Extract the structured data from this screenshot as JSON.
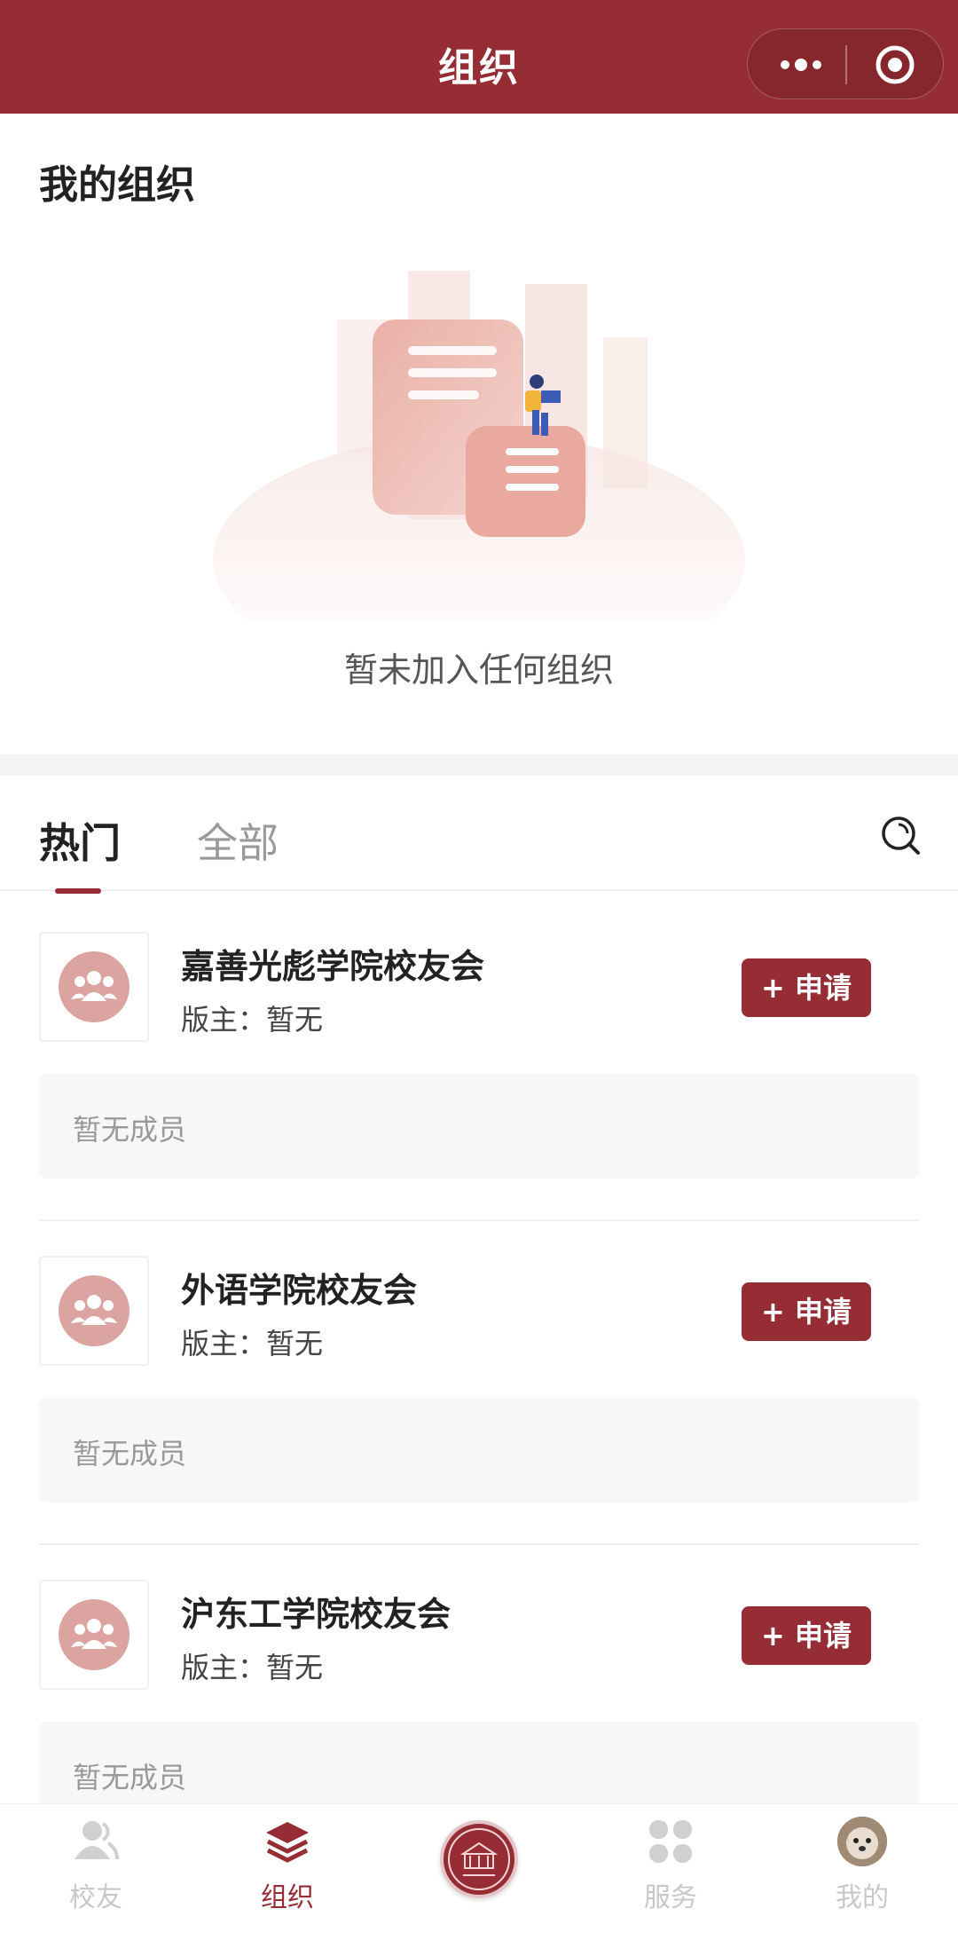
{
  "header": {
    "title": "组织"
  },
  "my_orgs": {
    "title": "我的组织",
    "empty_text": "暂未加入任何组织"
  },
  "tabs": [
    {
      "label": "热门",
      "active": true
    },
    {
      "label": "全部",
      "active": false
    }
  ],
  "orgs": [
    {
      "name": "嘉善光彪学院校友会",
      "owner_label": "版主：",
      "owner_value": "暂无",
      "apply_label": "+ 申请",
      "members_text": "暂无成员"
    },
    {
      "name": "外语学院校友会",
      "owner_label": "版主：",
      "owner_value": "暂无",
      "apply_label": "+ 申请",
      "members_text": "暂无成员"
    },
    {
      "name": "沪东工学院校友会",
      "owner_label": "版主：",
      "owner_value": "暂无",
      "apply_label": "+ 申请",
      "members_text": "暂无成员"
    }
  ],
  "nav": [
    {
      "label": "校友",
      "icon": "alumni-icon",
      "active": false
    },
    {
      "label": "组织",
      "icon": "layers-icon",
      "active": true
    },
    {
      "label": "",
      "icon": "school-emblem-icon",
      "active": false
    },
    {
      "label": "服务",
      "icon": "grid-icon",
      "active": false
    },
    {
      "label": "我的",
      "icon": "avatar",
      "active": false
    }
  ],
  "colors": {
    "primary": "#962c34",
    "avatar_pink": "#dca4a0",
    "muted_text": "#999999",
    "inactive_nav": "#c8c8c8"
  }
}
